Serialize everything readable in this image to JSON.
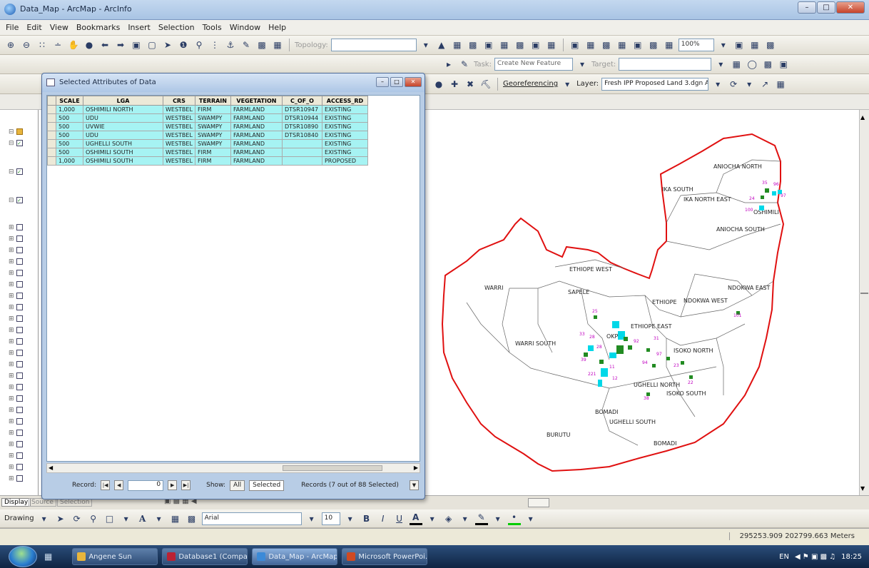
{
  "window": {
    "title": "Data_Map - ArcMap - ArcInfo"
  },
  "menu": [
    "File",
    "Edit",
    "View",
    "Bookmarks",
    "Insert",
    "Selection",
    "Tools",
    "Window",
    "Help"
  ],
  "toolbars": {
    "topology_label": "Topology:",
    "task_label": "Task:",
    "task_value": "Create New Feature",
    "target_label": "Target:",
    "georeferencing_label": "Georeferencing",
    "layer_label": "Layer:",
    "layer_value": "Fresh IPP Proposed Land 3.dgn A",
    "zoom_value": "100%"
  },
  "attribute_window": {
    "title": "Selected Attributes of Data",
    "columns": [
      "SCALE",
      "LGA",
      "CRS",
      "TERRAIN",
      "VEGETATION",
      "C_OF_O",
      "ACCESS_RD"
    ],
    "rows": [
      [
        "1,000",
        "OSHIMILI NORTH",
        "WESTBEL",
        "FIRM",
        "FARMLAND",
        "DTSR10947",
        "EXISTING"
      ],
      [
        "500",
        "UDU",
        "WESTBEL",
        "SWAMPY",
        "FARMLAND",
        "DTSR10944",
        "EXISTING"
      ],
      [
        "500",
        "UVWIE",
        "WESTBEL",
        "SWAMPY",
        "FARMLAND",
        "DTSR10890",
        "EXISTING"
      ],
      [
        "500",
        "UDU",
        "WESTBEL",
        "SWAMPY",
        "FARMLAND",
        "DTSR10840",
        "EXISTING"
      ],
      [
        "500",
        "UGHELLI SOUTH",
        "WESTBEL",
        "SWAMPY",
        "FARMLAND",
        "",
        "EXISTING"
      ],
      [
        "500",
        "OSHIMILI SOUTH",
        "WESTBEL",
        "FIRM",
        "FARMLAND",
        "",
        "EXISTING"
      ],
      [
        "1,000",
        "OSHIMILI SOUTH",
        "WESTBEL",
        "FIRM",
        "FARMLAND",
        "",
        "PROPOSED"
      ]
    ],
    "record_label": "Record:",
    "record_value": "0",
    "show_label": "Show:",
    "show_all": "All",
    "show_selected": "Selected",
    "records_summary": "Records (7 out of 88 Selected)"
  },
  "toc": {
    "tab_display": "Display",
    "tab_source": "Source",
    "tab_selection": "Selection"
  },
  "map": {
    "labels": [
      "ANIOCHA NORTH",
      "IKA SOUTH",
      "IKA NORTH EAST",
      "OSHIMILI",
      "ANIOCHA SOUTH",
      "ETHIOPE WEST",
      "WARRI",
      "SAPELE",
      "NDOKWA EAST",
      "ETHIOPE",
      "NDOKWA WEST",
      "ETHIOPE EAST",
      "OKPE",
      "WARRI SOUTH",
      "ISOKO NORTH",
      "UGHELLI NORTH",
      "ISOKO SOUTH",
      "BOMADI",
      "UGHELLI SOUTH",
      "BURUTU",
      "BOMADI"
    ],
    "point_labels": [
      "35",
      "96",
      "24",
      "97",
      "100",
      "101",
      "25",
      "33",
      "28",
      "28",
      "92",
      "31",
      "22",
      "23",
      "94",
      "11",
      "38",
      "39",
      "97",
      "221",
      "12"
    ],
    "boundary_color": "#e01010",
    "point_color_green": "#228b22",
    "point_color_cyan": "#00d8e8",
    "label_color": "#c000c0"
  },
  "drawing": {
    "label": "Drawing",
    "font": "Arial",
    "size": "10",
    "bold": "B",
    "italic": "I",
    "underline": "U"
  },
  "status": {
    "coordinates": "295253.909  202799.663 Meters"
  },
  "taskbar": {
    "items": [
      "Angene Sun",
      "Database1 (Compat...",
      "Data_Map - ArcMap...",
      "Microsoft PowerPoi..."
    ],
    "lang": "EN",
    "clock": "18:25"
  }
}
